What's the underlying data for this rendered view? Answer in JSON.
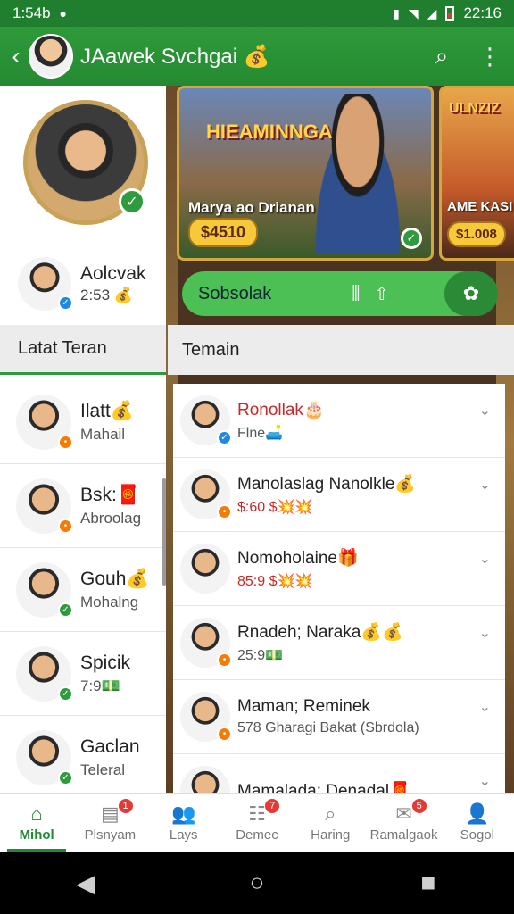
{
  "status_bar": {
    "time": "1:54b",
    "right_time": "22:16",
    "icons": [
      "notification-icon",
      "vibrate-icon",
      "wifi-icon",
      "signal-icon",
      "battery-icon"
    ]
  },
  "app_bar": {
    "title": "JAawek Svchgai",
    "title_emoji": "💰",
    "actions": [
      "search-icon",
      "more-vert-icon"
    ]
  },
  "profile": {
    "small_name": "Aolcvak",
    "small_sub": "2:53",
    "small_emoji": "💰"
  },
  "left_tab": "Latat Teran",
  "right_tab": "Temain",
  "cards": [
    {
      "banner": "HIEAMINNGA",
      "caption": "Marya ao Drianan",
      "price": "$4510"
    },
    {
      "banner": "ULNZIZ",
      "caption": "AME KASI",
      "price": "$1.008"
    }
  ],
  "search": {
    "text": "Sobsolak"
  },
  "left_list": [
    {
      "name": "Ilatt",
      "emoji": "💰",
      "sub": "Mahail",
      "badge": "orange"
    },
    {
      "name": "Bsk:",
      "emoji": "🧧",
      "sub": "Abroolag",
      "badge": "orange"
    },
    {
      "name": "Gouh",
      "emoji": "💰",
      "sub": "Mohalng",
      "badge": "green"
    },
    {
      "name": "Spicik",
      "emoji": "",
      "sub": "7:9",
      "sub_emoji": "💵",
      "badge": "green"
    },
    {
      "name": "Gaclan",
      "emoji": "",
      "sub": "Teleral",
      "badge": "green"
    }
  ],
  "right_list": [
    {
      "name": "Ronollak",
      "emoji": "🎂",
      "sub": "Flne",
      "sub_emoji": "🛋️",
      "red": true,
      "badge": "blue"
    },
    {
      "name": "Manolaslag Nanolkle",
      "emoji": "💰",
      "sub": "$:60 $",
      "sub_emoji": "💥💥",
      "sub_red": true,
      "badge": "orange"
    },
    {
      "name": "Nomoholaine",
      "emoji": "🎁",
      "sub": "85:9 $",
      "sub_emoji": "💥💥",
      "sub_red": true,
      "badge": ""
    },
    {
      "name": "Rnadeh; Naraka",
      "emoji": "💰💰",
      "sub": "25:9",
      "sub_emoji": "💵",
      "badge": "orange"
    },
    {
      "name": "Maman; Reminek",
      "emoji": "",
      "sub": "578 Gharagi Bakat (Sbrdola)",
      "badge": "orange"
    },
    {
      "name": "Mamalada; Denadal",
      "emoji": "🧧",
      "sub": "",
      "badge": ""
    }
  ],
  "bottom_nav": [
    {
      "label": "Mihol",
      "icon": "home-icon",
      "glyph": "⌂",
      "active": true,
      "badge": ""
    },
    {
      "label": "Plsnyam",
      "icon": "book-icon",
      "glyph": "▤",
      "active": false,
      "badge": "1"
    },
    {
      "label": "Lays",
      "icon": "people-icon",
      "glyph": "👥",
      "active": false,
      "badge": ""
    },
    {
      "label": "Demec",
      "icon": "grid-icon",
      "glyph": "☷",
      "active": false,
      "badge": "7"
    },
    {
      "label": "Haring",
      "icon": "search-icon",
      "glyph": "⌕",
      "active": false,
      "badge": ""
    },
    {
      "label": "Ramalgaok",
      "icon": "chat-icon",
      "glyph": "✉",
      "active": false,
      "badge": "5"
    },
    {
      "label": "Sogol",
      "icon": "person-icon",
      "glyph": "👤",
      "active": false,
      "badge": ""
    }
  ],
  "colors": {
    "primary": "#2e9b3e",
    "dark": "#1f7f2f",
    "accent": "#f7c93a",
    "red": "#c62828"
  }
}
